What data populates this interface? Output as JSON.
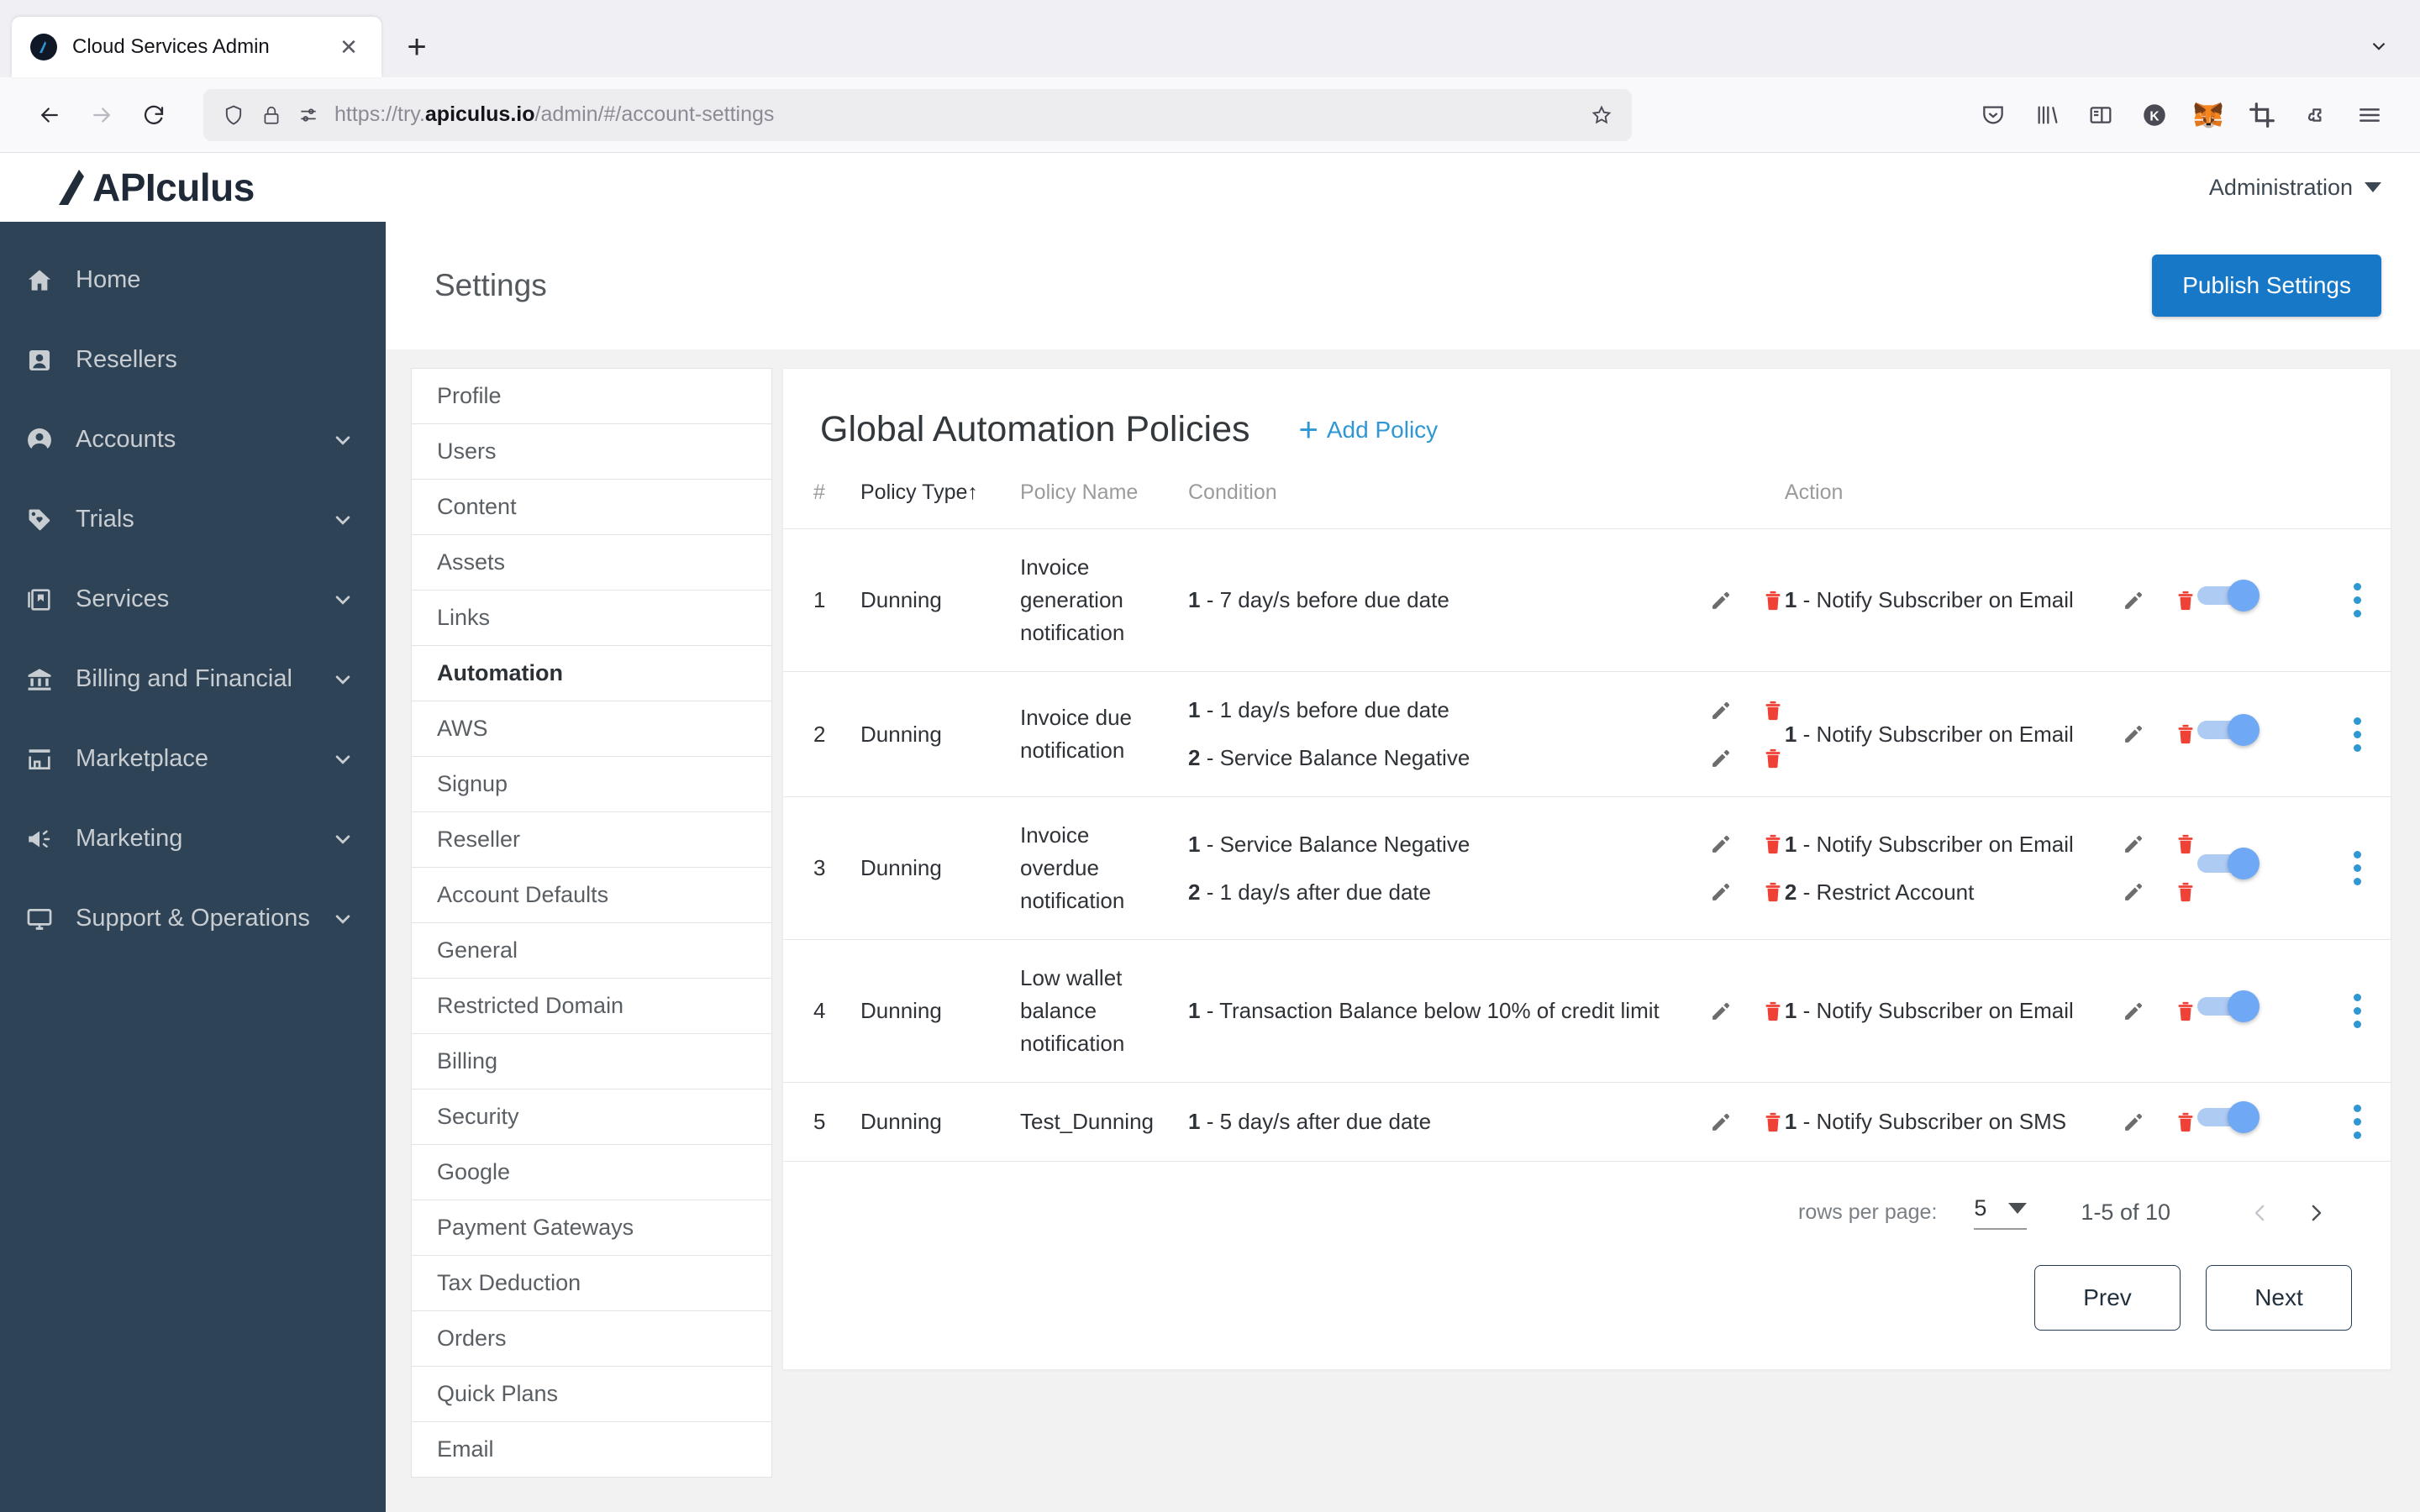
{
  "browser": {
    "tab": {
      "title": "Cloud Services Admin",
      "favicon": "apiculus-logo-icon",
      "close": "✕"
    },
    "new_tab": "+",
    "tabstrip_menu": "chevron-down-icon",
    "url": {
      "protocol": "https://try.",
      "domain": "apiculus.io",
      "path": "/admin/#/account-settings",
      "full": "https://try.apiculus.io/admin/#/account-settings"
    },
    "toolbar_icons": [
      "pocket-icon",
      "library-icon",
      "sidebar-icon",
      "keeper-extension-icon",
      "metamask-extension-icon",
      "screenshot-crop-icon",
      "extensions-puzzle-icon",
      "hamburger-menu-icon"
    ],
    "nav": {
      "back": "back-arrow-icon",
      "forward": "forward-arrow-icon",
      "reload": "reload-icon"
    }
  },
  "header": {
    "logo_text": "APIculus",
    "account_menu": "Administration"
  },
  "sidebar": {
    "items": [
      {
        "label": "Home",
        "icon": "home-icon",
        "expandable": false
      },
      {
        "label": "Resellers",
        "icon": "user-card-icon",
        "expandable": false
      },
      {
        "label": "Accounts",
        "icon": "account-circle-icon",
        "expandable": true
      },
      {
        "label": "Trials",
        "icon": "tag-icon",
        "expandable": true
      },
      {
        "label": "Services",
        "icon": "services-stack-icon",
        "expandable": true
      },
      {
        "label": "Billing and Financial",
        "icon": "bank-icon",
        "expandable": true
      },
      {
        "label": "Marketplace",
        "icon": "storefront-icon",
        "expandable": true
      },
      {
        "label": "Marketing",
        "icon": "megaphone-icon",
        "expandable": true
      },
      {
        "label": "Support & Operations",
        "icon": "monitor-icon",
        "expandable": true
      }
    ]
  },
  "settings_bar": {
    "title": "Settings",
    "publish_label": "Publish Settings"
  },
  "settings_nav": {
    "items": [
      {
        "label": "Profile",
        "active": false
      },
      {
        "label": "Users",
        "active": false
      },
      {
        "label": "Content",
        "active": false
      },
      {
        "label": "Assets",
        "active": false
      },
      {
        "label": "Links",
        "active": false
      },
      {
        "label": "Automation",
        "active": true
      },
      {
        "label": "AWS",
        "active": false
      },
      {
        "label": "Signup",
        "active": false
      },
      {
        "label": "Reseller",
        "active": false
      },
      {
        "label": "Account Defaults",
        "active": false
      },
      {
        "label": "General",
        "active": false
      },
      {
        "label": "Restricted Domain",
        "active": false
      },
      {
        "label": "Billing",
        "active": false
      },
      {
        "label": "Security",
        "active": false
      },
      {
        "label": "Google",
        "active": false
      },
      {
        "label": "Payment Gateways",
        "active": false
      },
      {
        "label": "Tax Deduction",
        "active": false
      },
      {
        "label": "Orders",
        "active": false
      },
      {
        "label": "Quick Plans",
        "active": false
      },
      {
        "label": "Email",
        "active": false
      }
    ]
  },
  "policies_panel": {
    "title": "Global Automation Policies",
    "add_policy_label": "Add Policy",
    "add_policy_icon": "plus-icon",
    "columns": {
      "num": "#",
      "policy_type": "Policy Type",
      "sort_indicator": "↑",
      "policy_name": "Policy Name",
      "condition": "Condition",
      "action": "Action"
    },
    "rows": [
      {
        "num": "1",
        "policy_type": "Dunning",
        "policy_name": "Invoice generation notification",
        "conditions": [
          {
            "index": "1",
            "text": "7 day/s before due date"
          }
        ],
        "actions": [
          {
            "index": "1",
            "text": "Notify Subscriber on Email"
          }
        ],
        "enabled": true
      },
      {
        "num": "2",
        "policy_type": "Dunning",
        "policy_name": "Invoice due notification",
        "conditions": [
          {
            "index": "1",
            "text": "1 day/s before due date"
          },
          {
            "index": "2",
            "text": "Service Balance Negative"
          }
        ],
        "actions": [
          {
            "index": "1",
            "text": "Notify Subscriber on Email"
          }
        ],
        "enabled": true
      },
      {
        "num": "3",
        "policy_type": "Dunning",
        "policy_name": "Invoice overdue notification",
        "conditions": [
          {
            "index": "1",
            "text": "Service Balance Negative"
          },
          {
            "index": "2",
            "text": "1 day/s after due date"
          }
        ],
        "actions": [
          {
            "index": "1",
            "text": "Notify Subscriber on Email"
          },
          {
            "index": "2",
            "text": "Restrict Account"
          }
        ],
        "enabled": true
      },
      {
        "num": "4",
        "policy_type": "Dunning",
        "policy_name": "Low wallet balance notification",
        "conditions": [
          {
            "index": "1",
            "text": "Transaction Balance below 10% of credit limit"
          }
        ],
        "actions": [
          {
            "index": "1",
            "text": "Notify Subscriber on Email"
          }
        ],
        "enabled": true
      },
      {
        "num": "5",
        "policy_type": "Dunning",
        "policy_name": "Test_Dunning",
        "conditions": [
          {
            "index": "1",
            "text": "5 day/s after due date"
          }
        ],
        "actions": [
          {
            "index": "1",
            "text": "Notify Subscriber on SMS"
          }
        ],
        "enabled": true
      }
    ],
    "row_icons": {
      "edit": "pencil-icon",
      "delete": "trash-icon",
      "more": "kebab-menu-icon",
      "toggle": "toggle-switch"
    },
    "pagination": {
      "rows_per_page_label": "rows per page:",
      "rows_per_page_value": "5",
      "range_label": "1-5 of 10",
      "prev_chevron": "chevron-left-icon",
      "next_chevron": "chevron-right-icon",
      "prev_label": "Prev",
      "next_label": "Next"
    }
  },
  "colors": {
    "sidebar_bg": "#2f4356",
    "accent_blue": "#1878c8",
    "link_blue": "#2e97d4",
    "toggle_on": "#6fa8f5",
    "delete_red": "#ef4136",
    "page_bg": "#f2f2f2"
  }
}
